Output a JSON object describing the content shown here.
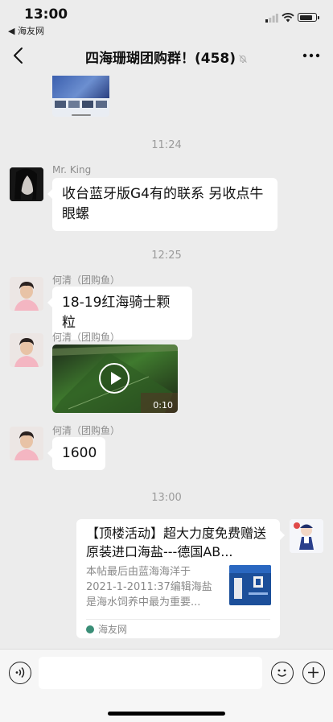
{
  "status_bar": {
    "time": "13:00",
    "back_app": "◀ 海友网"
  },
  "nav": {
    "title": "四海珊瑚团购群！(458)"
  },
  "timestamps": [
    "11:24",
    "12:25",
    "13:00"
  ],
  "messages": [
    {
      "sender": "Mr. King",
      "text": "收台蓝牙版G4有的联系 另收点牛眼螺"
    },
    {
      "sender": "何清（团购鱼）",
      "text": "18-19红海骑士颗粒"
    },
    {
      "sender": "何清（团购鱼）",
      "video_duration": "0:10"
    },
    {
      "sender": "何清（团购鱼）",
      "text": "1600"
    }
  ],
  "link_card": {
    "title": "【顶楼活动】超大力度免费赠送原装进口海盐---德国AB...",
    "description": "本帖最后由蓝海海洋于 2021-1-2011:37编辑海盐是海水饲养中最为重要...",
    "source": "海友网"
  },
  "colors": {
    "background": "#ececec",
    "bubble": "#ffffff",
    "timestamp": "#9b9b9b"
  }
}
